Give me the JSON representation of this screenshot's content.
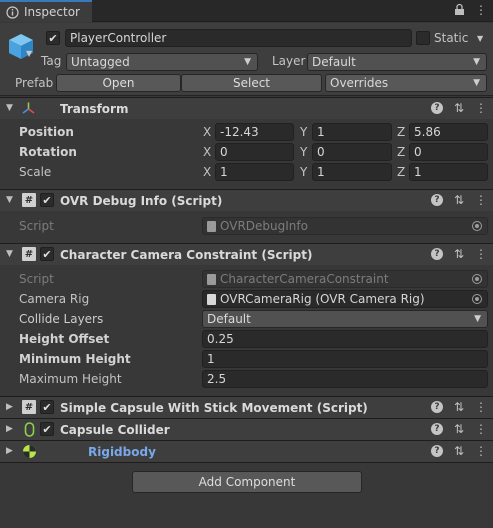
{
  "tab": {
    "icon": "info-icon",
    "label": "Inspector"
  },
  "object": {
    "active": true,
    "name": "PlayerController",
    "static_label": "Static",
    "static_checked": false,
    "tag_label": "Tag",
    "tag_value": "Untagged",
    "layer_label": "Layer",
    "layer_value": "Default",
    "prefab_label": "Prefab",
    "open_label": "Open",
    "select_label": "Select",
    "overrides_label": "Overrides"
  },
  "transform": {
    "title": "Transform",
    "position_label": "Position",
    "rotation_label": "Rotation",
    "scale_label": "Scale",
    "axis_x": "X",
    "axis_y": "Y",
    "axis_z": "Z",
    "position": {
      "x": "-12.43",
      "y": "1",
      "z": "5.86"
    },
    "rotation": {
      "x": "0",
      "y": "0",
      "z": "0"
    },
    "scale": {
      "x": "1",
      "y": "1",
      "z": "1"
    }
  },
  "ovr_debug": {
    "title": "OVR Debug Info (Script)",
    "script_label": "Script",
    "script_value": "OVRDebugInfo"
  },
  "char_cam": {
    "title": "Character Camera Constraint (Script)",
    "script_label": "Script",
    "script_value": "CharacterCameraConstraint",
    "camera_rig_label": "Camera Rig",
    "camera_rig_value": "OVRCameraRig (OVR Camera Rig)",
    "collide_layers_label": "Collide Layers",
    "collide_layers_value": "Default",
    "height_offset_label": "Height Offset",
    "height_offset_value": "0.25",
    "min_height_label": "Minimum Height",
    "min_height_value": "1",
    "max_height_label": "Maximum Height",
    "max_height_value": "2.5"
  },
  "simple_capsule": {
    "title": "Simple Capsule With Stick Movement (Script)"
  },
  "capsule_collider": {
    "title": "Capsule Collider"
  },
  "rigidbody": {
    "title": "Rigidbody"
  },
  "add_component_label": "Add Component",
  "colors": {
    "accent": "#3a79bb",
    "rigidbody_title": "#7aa7e8"
  }
}
